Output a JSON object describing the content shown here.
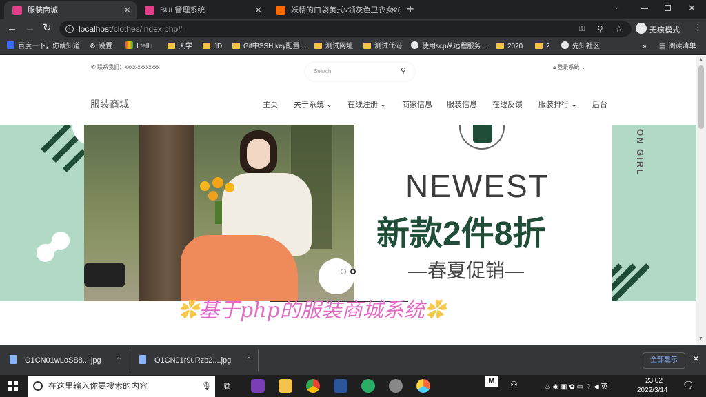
{
  "browser": {
    "tabs": [
      {
        "title": "服装商城",
        "active": true
      },
      {
        "title": "BUI 管理系统",
        "active": false
      },
      {
        "title": "妖精的口袋美式v领灰色卫衣女2(",
        "active": false
      }
    ],
    "url_host": "localhost",
    "url_path": "/clothes/index.php#",
    "profile_label": "无痕模式",
    "bookmarks": [
      "百度一下，你就知道",
      "设置",
      "I tell u",
      "天学",
      "JD",
      "Git中SSH key配置...",
      "测试网址",
      "测试代码",
      "使用scp从远程服务...",
      "2020",
      "2",
      "先知社区"
    ],
    "reading_list": "阅读清单",
    "more_bookmarks": "»"
  },
  "site": {
    "contact": "联系我们：xxxx-xxxxxxxx",
    "search_placeholder": "Search",
    "login": "登录系统",
    "brand": "服装商城",
    "nav": [
      {
        "label": "主页",
        "dropdown": false
      },
      {
        "label": "关于系统",
        "dropdown": true
      },
      {
        "label": "在线注册",
        "dropdown": true
      },
      {
        "label": "商家信息",
        "dropdown": false
      },
      {
        "label": "服装信息",
        "dropdown": false
      },
      {
        "label": "在线反馈",
        "dropdown": false
      },
      {
        "label": "服装排行",
        "dropdown": true
      },
      {
        "label": "后台",
        "dropdown": false
      }
    ]
  },
  "banner": {
    "headline_en": "NEWEST",
    "headline_cn": "新款2件8折",
    "subline": "—春夏促销—",
    "side_text": "ON GIRL",
    "slide_count": 2,
    "active_slide": 2
  },
  "overlay_caption": "基于php的服装商城系统",
  "downloads": {
    "items": [
      "O1CN01wLoSB8....jpg",
      "O1CN01r9uRzb2....jpg"
    ],
    "show_all": "全部显示"
  },
  "taskbar": {
    "search_placeholder": "在这里输入你要搜索的内容",
    "time": "23:02",
    "date": "2022/3/14"
  },
  "colors": {
    "mint": "#b2d9c6",
    "dark_green": "#1f4d38",
    "caption_pink": "#e06cc4",
    "chrome_dark": "#35363a"
  }
}
